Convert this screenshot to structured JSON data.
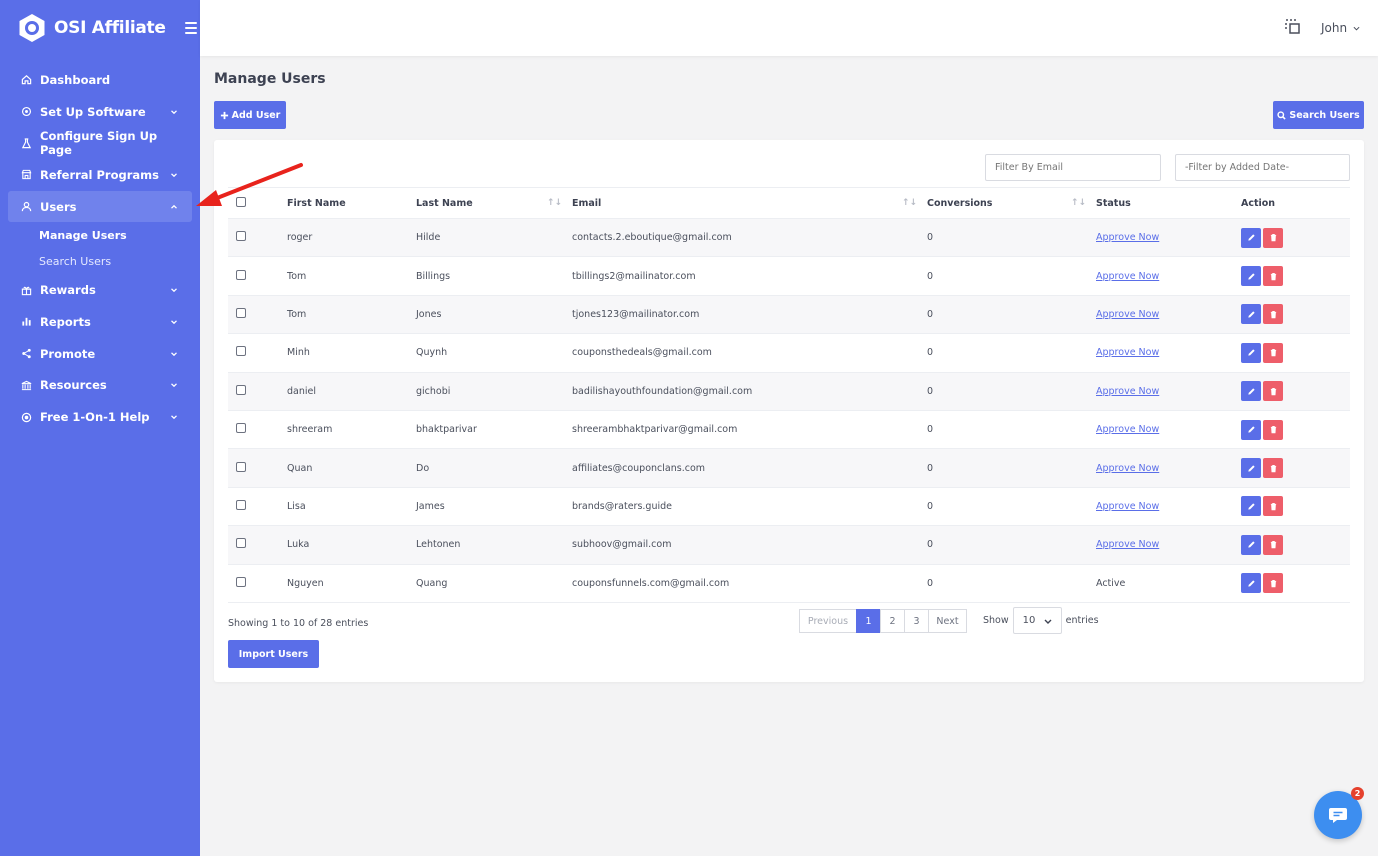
{
  "brand": {
    "name": "OSI Affiliate"
  },
  "sidebar": {
    "items": [
      {
        "label": "Dashboard",
        "icon": "home-icon",
        "chevron": false
      },
      {
        "label": "Set Up Software",
        "icon": "settings-icon",
        "chevron": true
      },
      {
        "label": "Configure Sign Up Page",
        "icon": "flask-icon",
        "chevron": false
      },
      {
        "label": "Referral Programs",
        "icon": "store-icon",
        "chevron": true
      },
      {
        "label": "Users",
        "icon": "user-icon",
        "chevron": true,
        "active": true
      },
      {
        "label": "Rewards",
        "icon": "gift-icon",
        "chevron": true
      },
      {
        "label": "Reports",
        "icon": "bar-chart-icon",
        "chevron": true
      },
      {
        "label": "Promote",
        "icon": "share-icon",
        "chevron": true
      },
      {
        "label": "Resources",
        "icon": "bank-icon",
        "chevron": true
      },
      {
        "label": "Free 1-On-1 Help",
        "icon": "lifebuoy-icon",
        "chevron": true
      }
    ],
    "users_submenu": [
      "Manage Users",
      "Search Users"
    ]
  },
  "topbar": {
    "user_name": "John"
  },
  "page": {
    "title": "Manage Users",
    "add_user_label": "Add User",
    "search_users_label": "Search Users",
    "filter_email_placeholder": "Filter By Email",
    "filter_date_placeholder": "-Filter by Added Date-",
    "import_users_label": "Import Users"
  },
  "table": {
    "columns": [
      "First Name",
      "Last Name",
      "Email",
      "Conversions",
      "Status",
      "Action"
    ],
    "rows": [
      {
        "first": "roger",
        "last": "Hilde",
        "email": "contacts.2.eboutique@gmail.com",
        "conversions": "0",
        "status": "Approve Now"
      },
      {
        "first": "Tom",
        "last": "Billings",
        "email": "tbillings2@mailinator.com",
        "conversions": "0",
        "status": "Approve Now"
      },
      {
        "first": "Tom",
        "last": "Jones",
        "email": "tjones123@mailinator.com",
        "conversions": "0",
        "status": "Approve Now"
      },
      {
        "first": "Minh",
        "last": "Quynh",
        "email": "couponsthedeals@gmail.com",
        "conversions": "0",
        "status": "Approve Now"
      },
      {
        "first": "daniel",
        "last": "gichobi",
        "email": "badilishayouthfoundation@gmail.com",
        "conversions": "0",
        "status": "Approve Now"
      },
      {
        "first": "shreeram",
        "last": "bhaktparivar",
        "email": "shreerambhaktparivar@gmail.com",
        "conversions": "0",
        "status": "Approve Now"
      },
      {
        "first": "Quan",
        "last": "Do",
        "email": "affiliates@couponclans.com",
        "conversions": "0",
        "status": "Approve Now"
      },
      {
        "first": "Lisa",
        "last": "James",
        "email": "brands@raters.guide",
        "conversions": "0",
        "status": "Approve Now"
      },
      {
        "first": "Luka",
        "last": "Lehtonen",
        "email": "subhoov@gmail.com",
        "conversions": "0",
        "status": "Approve Now"
      },
      {
        "first": "Nguyen",
        "last": "Quang",
        "email": "couponsfunnels.com@gmail.com",
        "conversions": "0",
        "status": "Active"
      }
    ]
  },
  "pagination": {
    "summary": "Showing 1 to 10 of 28 entries",
    "previous": "Previous",
    "pages": [
      "1",
      "2",
      "3"
    ],
    "current": "1",
    "next": "Next",
    "show_label": "Show",
    "page_size": "10",
    "entries_label": "entries"
  },
  "chat": {
    "badge": "2"
  },
  "colors": {
    "accent": "#5a6ee8",
    "danger": "#ee5e6a",
    "annotation": "#e8231c"
  }
}
